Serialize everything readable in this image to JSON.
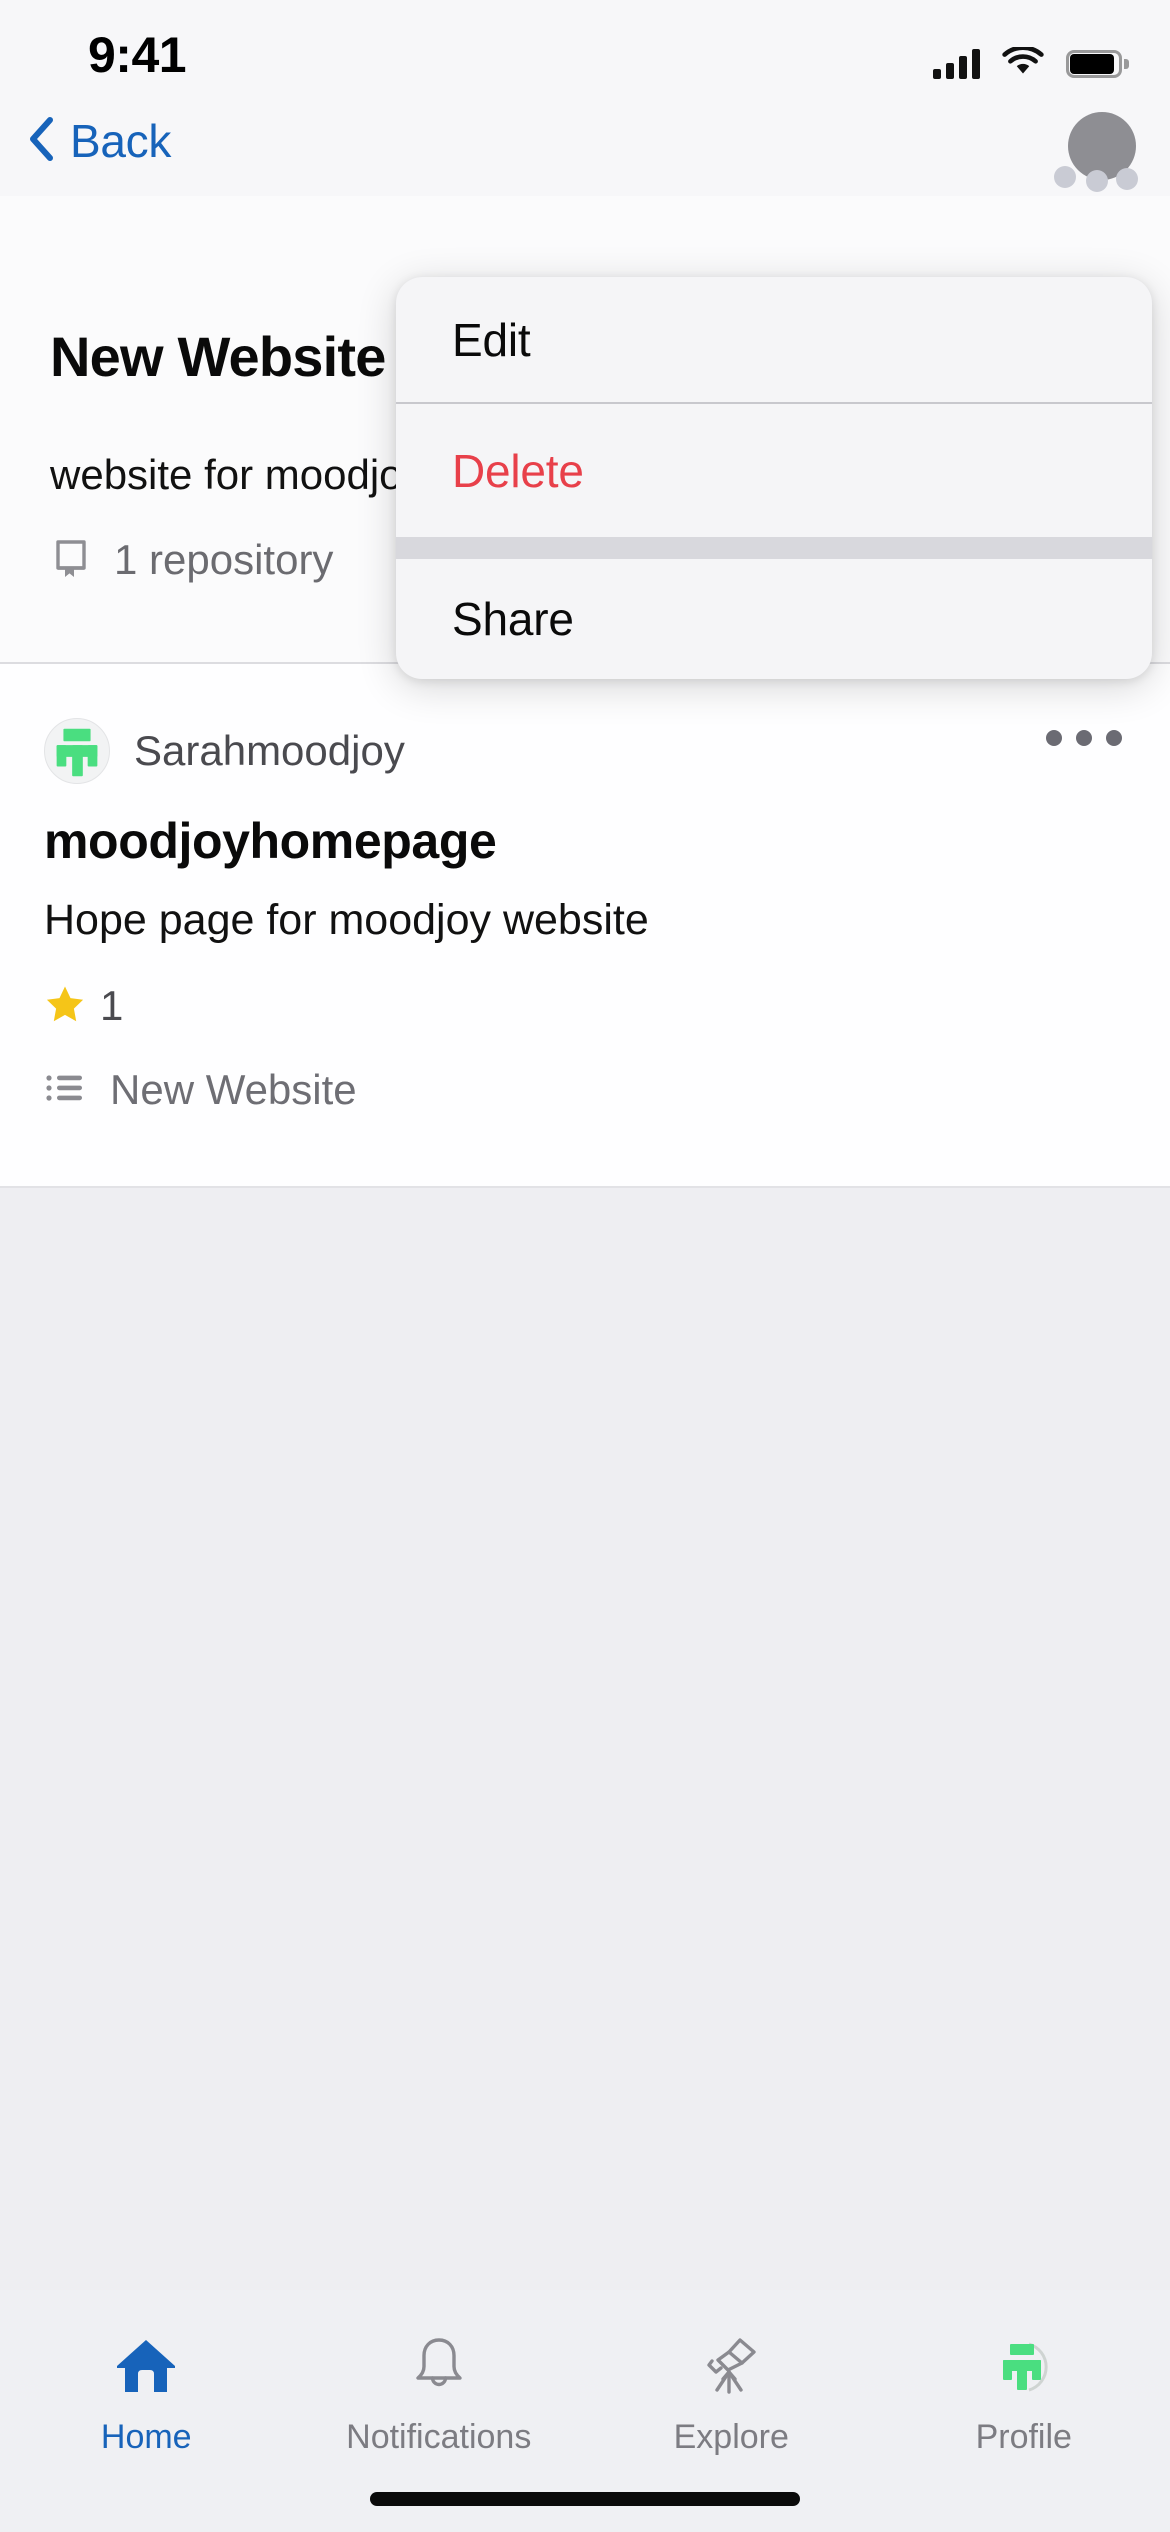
{
  "status_bar": {
    "time": "9:41",
    "cellular_icon": "cellular-signal-icon",
    "wifi_icon": "wifi-icon",
    "battery_icon": "battery-full-icon"
  },
  "nav_bar": {
    "back_label": "Back",
    "back_icon": "chevron-left-icon",
    "avatar_icon": "user-avatar",
    "accent_color": "#1763ba"
  },
  "project": {
    "title": "New Website",
    "description": "website for moodjoy",
    "repo_count_label": "1 repository",
    "repo_icon": "repo-book-icon"
  },
  "context_menu": {
    "items": [
      {
        "label": "Edit",
        "style": "default",
        "name": "menu-item-edit"
      },
      {
        "label": "Delete",
        "style": "destructive",
        "name": "menu-item-delete"
      },
      {
        "label": "Share",
        "style": "default",
        "name": "menu-item-share"
      }
    ],
    "destructive_color": "#e8404a"
  },
  "repository": {
    "owner": "Sarahmoodjoy",
    "owner_avatar_icon": "moodjoy-logo-avatar",
    "name": "moodjoyhomepage",
    "description": "Hope page for moodjoy website",
    "star_count": "1",
    "star_icon": "star-filled-icon",
    "group_label": "New Website",
    "group_icon": "list-icon",
    "overflow_icon": "ellipsis-horizontal-icon"
  },
  "tab_bar": {
    "active_index": 0,
    "active_color": "#1763ba",
    "inactive_color": "#7c7c82",
    "tabs": [
      {
        "label": "Home",
        "icon": "home-icon"
      },
      {
        "label": "Notifications",
        "icon": "bell-icon"
      },
      {
        "label": "Explore",
        "icon": "telescope-icon"
      },
      {
        "label": "Profile",
        "icon": "profile-logo-icon"
      }
    ]
  }
}
